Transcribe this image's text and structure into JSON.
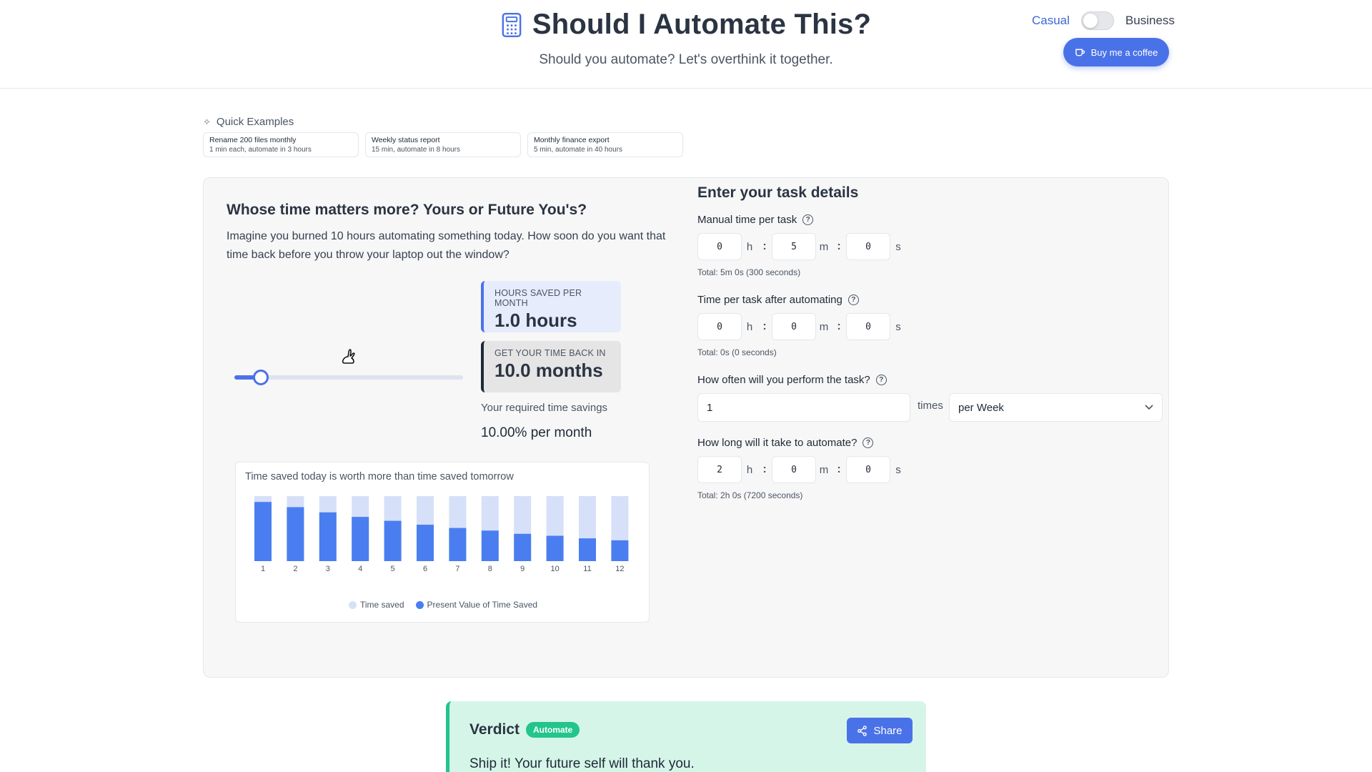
{
  "header": {
    "title": "Should I Automate This?",
    "subtitle": "Should you automate? Let's overthink it together.",
    "mode_casual": "Casual",
    "mode_business": "Business",
    "coffee_label": "Buy me a coffee",
    "title_icon": "calculator-icon"
  },
  "quick_examples": {
    "label": "Quick Examples",
    "items": [
      {
        "title": "Rename 200 files monthly",
        "desc": "1 min each, automate in 3 hours"
      },
      {
        "title": "Weekly status report",
        "desc": "15 min, automate in 8 hours"
      },
      {
        "title": "Monthly finance export",
        "desc": "5 min, automate in 40 hours"
      }
    ]
  },
  "left": {
    "title": "Whose time matters more? Yours or Future You's?",
    "description": "Imagine you burned 10 hours automating something today. How soon do you want that time back before you throw your laptop out the window?",
    "slider_value": 0.12,
    "hours_saved_label": "Hours saved per month",
    "hours_saved_value": "1.0 hours",
    "time_back_label": "Get your time back in",
    "time_back_value": "10.0 months",
    "required_label": "Your required time savings",
    "required_value": "10.00% per month"
  },
  "chart_data": {
    "type": "bar",
    "title": "Time saved today is worth more than time saved tomorrow",
    "categories": [
      "1",
      "2",
      "3",
      "4",
      "5",
      "6",
      "7",
      "8",
      "9",
      "10",
      "11",
      "12"
    ],
    "series": [
      {
        "name": "Time saved",
        "values": [
          1,
          1,
          1,
          1,
          1,
          1,
          1,
          1,
          1,
          1,
          1,
          1
        ],
        "color": "#d6e0f8"
      },
      {
        "name": "Present Value of Time Saved",
        "values": [
          0.91,
          0.83,
          0.75,
          0.68,
          0.62,
          0.56,
          0.51,
          0.47,
          0.42,
          0.39,
          0.35,
          0.32
        ],
        "color": "#4a7ef0"
      }
    ],
    "ylim": [
      0,
      1
    ],
    "legend": "bottom"
  },
  "form": {
    "title": "Enter your task details",
    "manual": {
      "label": "Manual time per task",
      "h": "0",
      "m": "5",
      "s": "0",
      "total": "Total: 5m 0s (300 seconds)"
    },
    "after": {
      "label": "Time per task after automating",
      "h": "0",
      "m": "0",
      "s": "0",
      "total": "Total: 0s (0 seconds)"
    },
    "frequency": {
      "label": "How often will you perform the task?",
      "value": "1",
      "times": "times",
      "period": "per Week"
    },
    "automate": {
      "label": "How long will it take to automate?",
      "h": "2",
      "m": "0",
      "s": "0",
      "total": "Total: 2h 0s (7200 seconds)"
    },
    "units": {
      "h": "h",
      "m": "m",
      "s": "s",
      "sep": ":"
    }
  },
  "verdict": {
    "title": "Verdict",
    "badge": "Automate",
    "share_label": "Share",
    "text": "Ship it! Your future self will thank you."
  }
}
